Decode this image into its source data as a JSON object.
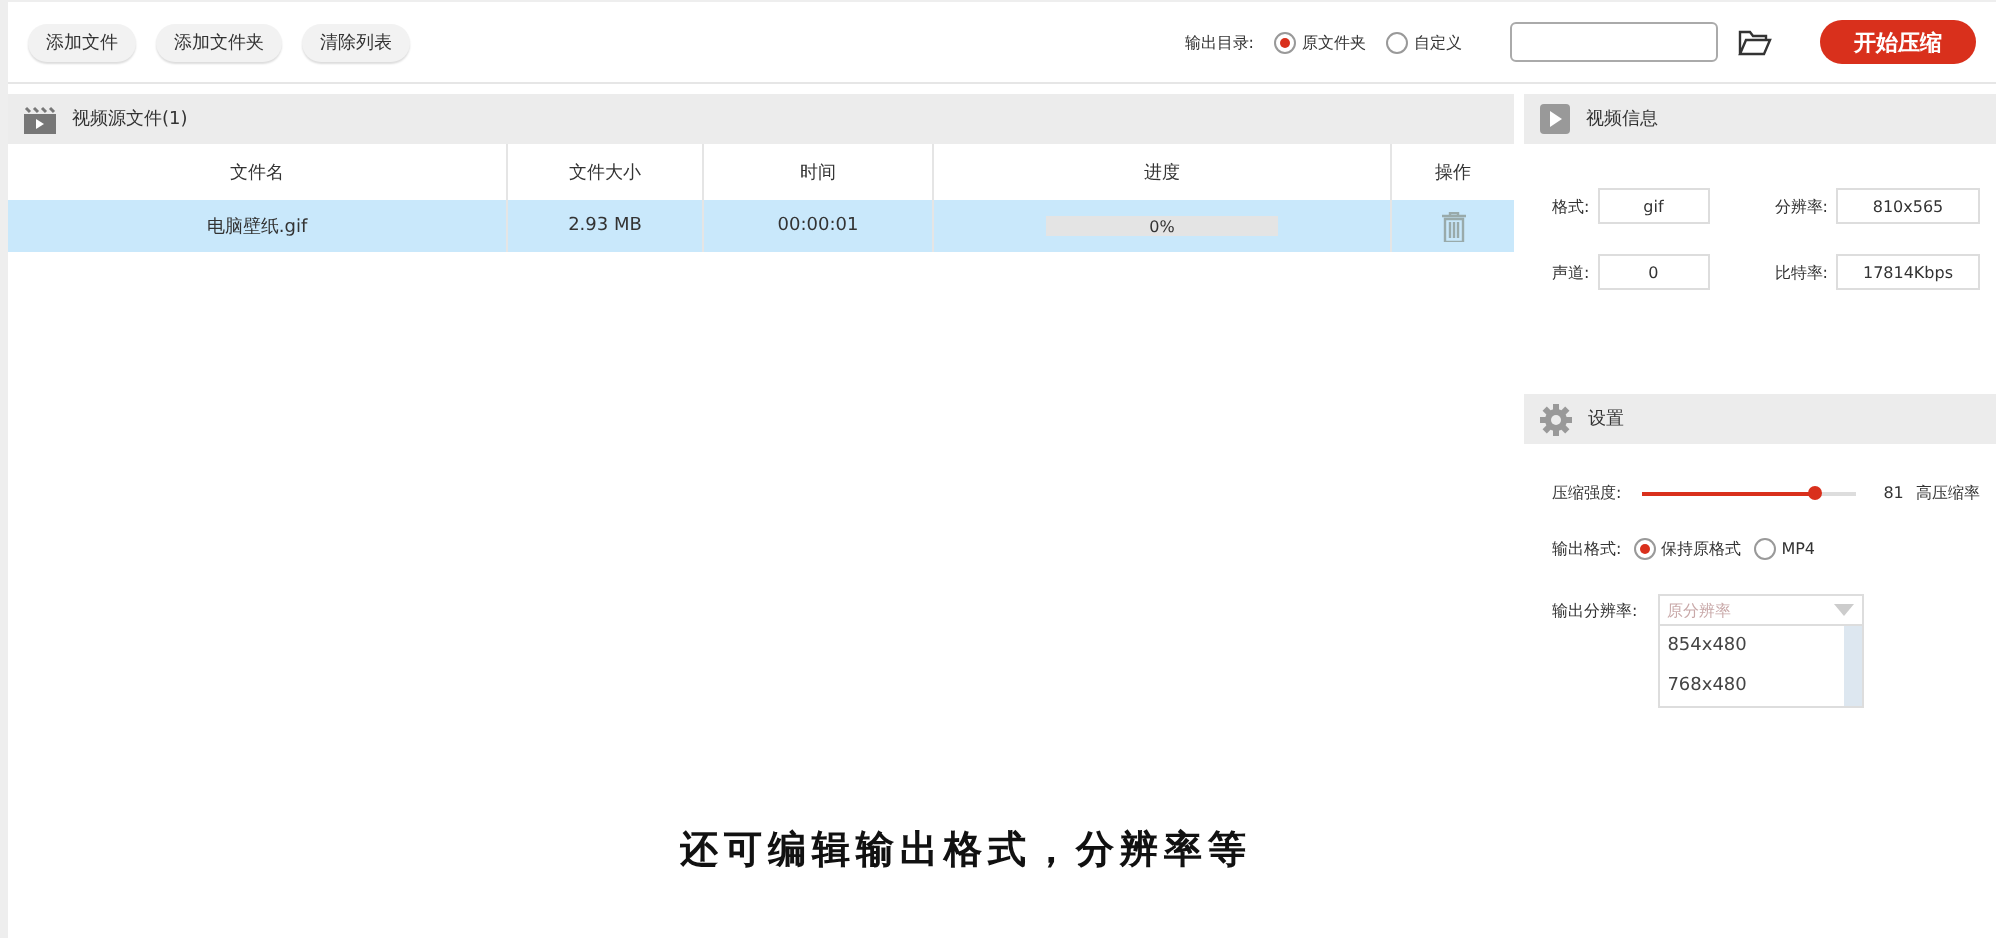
{
  "toolbar": {
    "buttons": [
      "添加文件",
      "添加文件夹",
      "清除列表"
    ],
    "output_dir_label": "输出目录:",
    "output_dir_options": [
      {
        "label": "原文件夹",
        "selected": true
      },
      {
        "label": "自定义",
        "selected": false
      }
    ],
    "start_button": "开始压缩"
  },
  "file_panel": {
    "title": "视频源文件(1)",
    "columns": [
      "文件名",
      "文件大小",
      "时间",
      "进度",
      "操作"
    ],
    "rows": [
      {
        "name": "电脑壁纸.gif",
        "size": "2.93 MB",
        "time": "00:00:01",
        "progress": {
          "level": 0,
          "reading": "0%"
        },
        "selected": true
      }
    ]
  },
  "video_info": {
    "title": "视频信息",
    "fields": [
      {
        "label": "格式:",
        "value": "gif"
      },
      {
        "label": "分辨率:",
        "value": "810x565"
      },
      {
        "label": "声道:",
        "value": "0"
      },
      {
        "label": "比特率:",
        "value": "17814Kbps"
      }
    ]
  },
  "settings": {
    "title": "设置",
    "strength": {
      "label": "压缩强度:",
      "level": 0.81,
      "reading": "81",
      "hint": "高压缩率"
    },
    "format": {
      "label": "输出格式:",
      "options": [
        {
          "label": "保持原格式",
          "selected": true
        },
        {
          "label": "MP4",
          "selected": false
        }
      ]
    },
    "resolution": {
      "label": "输出分辨率:",
      "placeholder": "原分辨率",
      "expanded": true,
      "options": [
        "854x480",
        "768x480"
      ]
    }
  },
  "caption": "还可编辑输出格式，分辨率等"
}
